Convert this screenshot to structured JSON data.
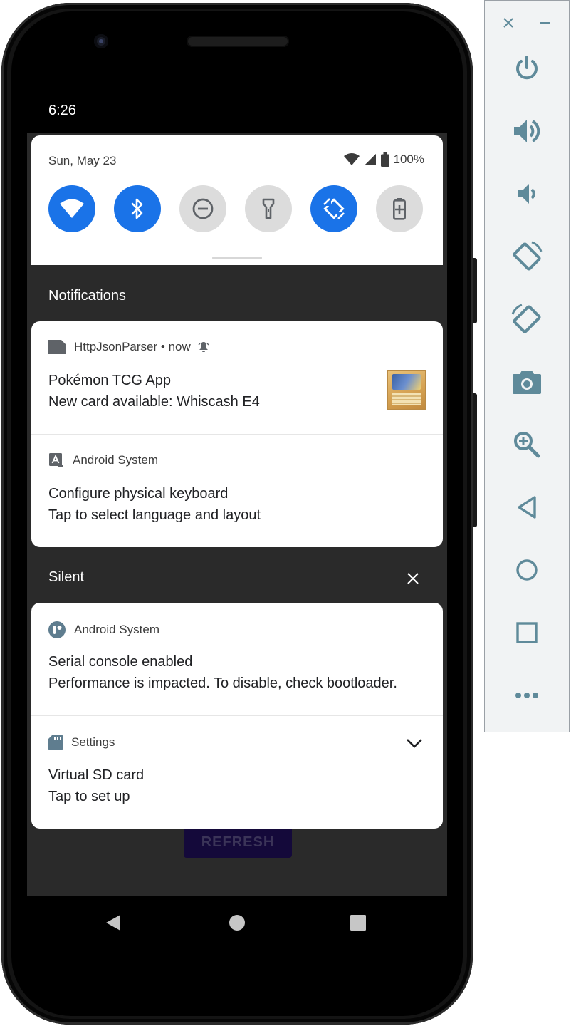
{
  "status_bar": {
    "time": "6:26"
  },
  "quick_settings": {
    "date": "Sun, May 23",
    "battery": "100%",
    "tiles": [
      {
        "name": "wifi",
        "icon": "wifi-icon",
        "state": "on"
      },
      {
        "name": "bluetooth",
        "icon": "bluetooth-icon",
        "state": "on"
      },
      {
        "name": "do-not-disturb",
        "icon": "do-not-disturb-icon",
        "state": "off"
      },
      {
        "name": "flashlight",
        "icon": "flashlight-icon",
        "state": "off"
      },
      {
        "name": "auto-rotate",
        "icon": "auto-rotate-icon",
        "state": "on"
      },
      {
        "name": "battery-saver",
        "icon": "battery-saver-icon",
        "state": "off"
      }
    ]
  },
  "sections": {
    "notifications_label": "Notifications",
    "silent_label": "Silent"
  },
  "notifications": [
    {
      "app": "HttpJsonParser",
      "separator": " • ",
      "time": "now",
      "title": "Pokémon TCG App",
      "text": "New card available: Whiscash E4"
    },
    {
      "app": "Android System",
      "title": "Configure physical keyboard",
      "text": "Tap to select language and layout"
    }
  ],
  "silent_notifications": [
    {
      "app": "Android System",
      "title": "Serial console enabled",
      "text": "Performance is impacted. To disable, check bootloader."
    },
    {
      "app": "Settings",
      "title": "Virtual SD card",
      "text": "Tap to set up"
    }
  ],
  "app_behind": {
    "refresh_label": "REFRESH"
  },
  "nav_bar": {
    "back": "back-icon",
    "home": "home-icon",
    "recents": "recents-icon"
  },
  "emulator_toolbar": {
    "buttons": [
      "power-icon",
      "volume-up-icon",
      "volume-down-icon",
      "rotate-left-icon",
      "rotate-right-icon",
      "camera-icon",
      "zoom-icon",
      "back-icon",
      "home-icon",
      "overview-icon",
      "more-icon"
    ]
  },
  "colors": {
    "accent": "#1a73e8",
    "tile_off": "#dcdcdc",
    "shade_bg": "#2a2a2a",
    "toolbar_icon": "#5f8a9a"
  }
}
